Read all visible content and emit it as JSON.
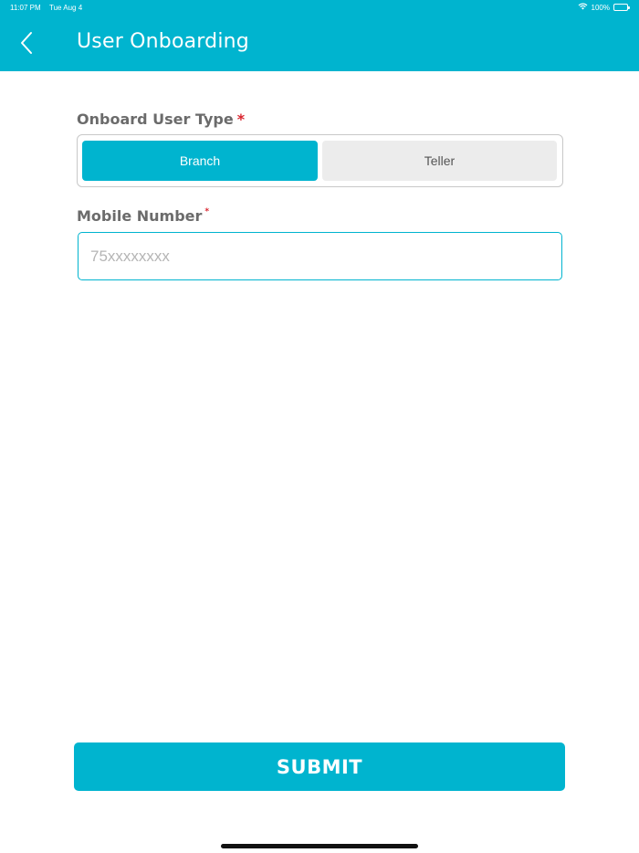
{
  "status_bar": {
    "time": "11:07 PM",
    "date": "Tue Aug 4",
    "battery": "100%",
    "battery_level": 1.0,
    "wifi_icon": "wifi-icon",
    "battery_icon": "battery-icon"
  },
  "header": {
    "title": "User Onboarding",
    "back_icon": "chevron-left-icon",
    "background": "#00b4cf"
  },
  "form": {
    "user_type": {
      "label": "Onboard User Type",
      "required_mark": "*",
      "options": [
        {
          "label": "Branch",
          "selected": true
        },
        {
          "label": "Teller",
          "selected": false
        }
      ]
    },
    "mobile": {
      "label": "Mobile Number",
      "required_mark": "*",
      "value": "",
      "placeholder": "75xxxxxxxx"
    }
  },
  "submit": {
    "label": "SUBMIT"
  },
  "colors": {
    "accent": "#00b4cf",
    "required": "#d9232d",
    "label": "#6b6b6b",
    "unselected": "#ececec"
  }
}
